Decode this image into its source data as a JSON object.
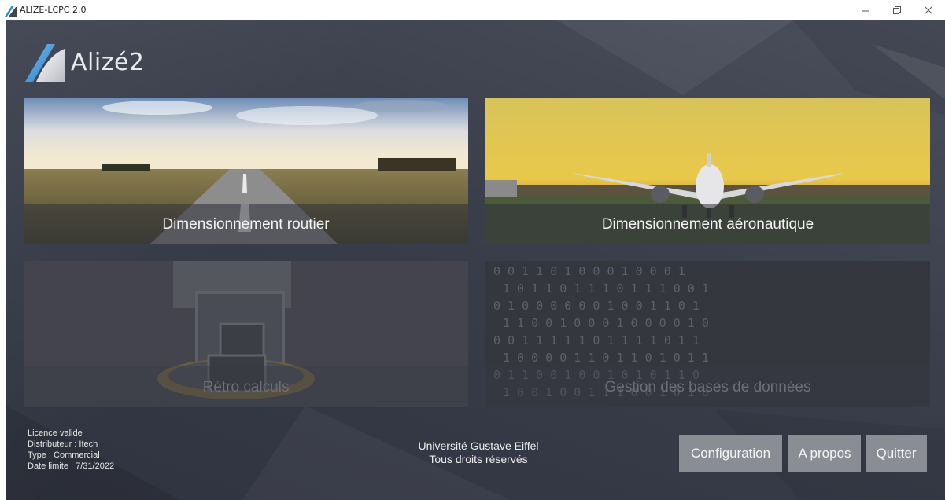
{
  "window": {
    "title": "ALIZE-LCPC 2.0"
  },
  "header": {
    "logo_text": "Alizé2"
  },
  "tiles": [
    {
      "label": "Dimensionnement routier",
      "enabled": true
    },
    {
      "label": "Dimensionnement aéronautique",
      "enabled": true
    },
    {
      "label": "Rétro calculs",
      "enabled": false
    },
    {
      "label": "Gestion des bases de données",
      "enabled": false
    }
  ],
  "license": {
    "status": "Licence valide",
    "distributor": "Distributeur : Itech",
    "type": "Type : Commercial",
    "expiry": "Date limite : 7/31/2022"
  },
  "footer": {
    "org": "Université Gustave Eiffel",
    "rights": "Tous droits réservés"
  },
  "buttons": {
    "configuration": "Configuration",
    "about": "A propos",
    "quit": "Quitter"
  },
  "binary_rows": [
    "0 0 1 1 0 1 0 0 0 1 0 0 0 1",
    "1 0 1 1 0 1 1 1 0 1 1 1 0 0 1",
    "0 1 0 0 0 0 0 0 1 0 0 1 1 0 1",
    "1 1 0 0 1 0 0 0 1 0 0 0 0 1 0",
    "0 0 1 1 1 1 1 0 1 1 1 1 0 1 1",
    "1 0 0 0 0 1 1 0 1 1 0 1 0 1 1",
    "0 1 1 0 0 1 0 0 1 0 1 0 1 1 0",
    "1 0 0 1 0 0 1 1 1 0 0 1 0 1 0"
  ],
  "colors": {
    "background": "#3a3e4b",
    "button": "#8b8d94",
    "accent": "#2d8fd5"
  }
}
